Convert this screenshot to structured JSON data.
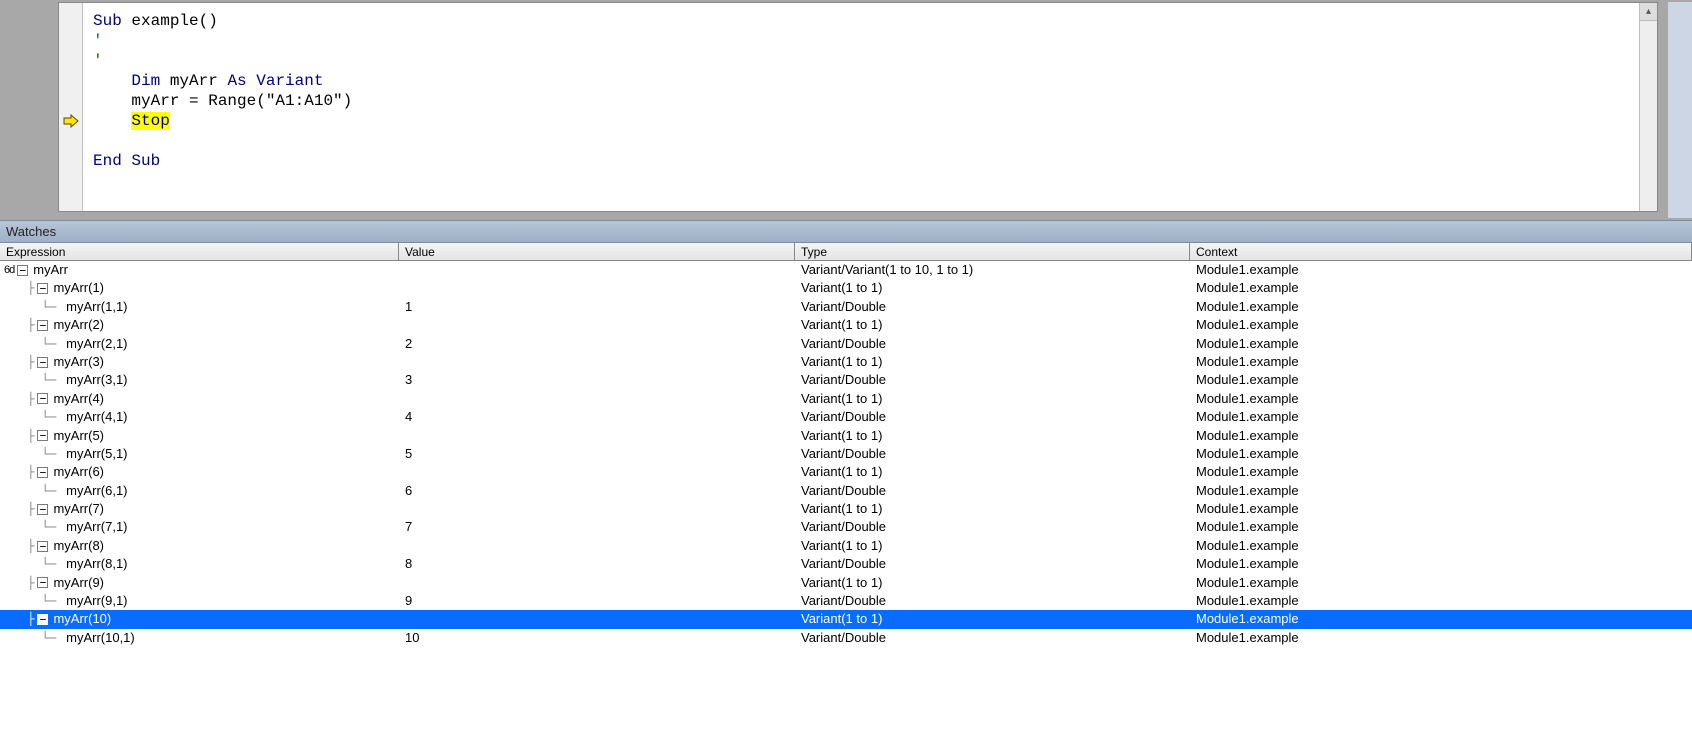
{
  "code": {
    "line1_a": "Sub",
    "line1_b": " example()",
    "line2": "'",
    "line3": "'",
    "line4_a": "    Dim",
    "line4_b": " myArr ",
    "line4_c": "As Variant",
    "line5": "    myArr = Range(\"A1:A10\")",
    "line6_pad": "    ",
    "line6_stop": "Stop",
    "line8": "End Sub"
  },
  "watches": {
    "title": "Watches",
    "headers": {
      "expression": "Expression",
      "value": "Value",
      "type": "Type",
      "context": "Context"
    },
    "rows": [
      {
        "indent": 0,
        "glasses": true,
        "box": "-",
        "expr": "myArr",
        "value": "",
        "type": "Variant/Variant(1 to 10, 1 to 1)",
        "context": "Module1.example",
        "selected": false
      },
      {
        "indent": 1,
        "box": "-",
        "expr": "myArr(1)",
        "value": "",
        "type": "Variant(1 to 1)",
        "context": "Module1.example",
        "selected": false
      },
      {
        "indent": 2,
        "expr": "myArr(1,1)",
        "value": "1",
        "type": "Variant/Double",
        "context": "Module1.example",
        "selected": false
      },
      {
        "indent": 1,
        "box": "-",
        "expr": "myArr(2)",
        "value": "",
        "type": "Variant(1 to 1)",
        "context": "Module1.example",
        "selected": false
      },
      {
        "indent": 2,
        "expr": "myArr(2,1)",
        "value": "2",
        "type": "Variant/Double",
        "context": "Module1.example",
        "selected": false
      },
      {
        "indent": 1,
        "box": "-",
        "expr": "myArr(3)",
        "value": "",
        "type": "Variant(1 to 1)",
        "context": "Module1.example",
        "selected": false
      },
      {
        "indent": 2,
        "expr": "myArr(3,1)",
        "value": "3",
        "type": "Variant/Double",
        "context": "Module1.example",
        "selected": false
      },
      {
        "indent": 1,
        "box": "-",
        "expr": "myArr(4)",
        "value": "",
        "type": "Variant(1 to 1)",
        "context": "Module1.example",
        "selected": false
      },
      {
        "indent": 2,
        "expr": "myArr(4,1)",
        "value": "4",
        "type": "Variant/Double",
        "context": "Module1.example",
        "selected": false
      },
      {
        "indent": 1,
        "box": "-",
        "expr": "myArr(5)",
        "value": "",
        "type": "Variant(1 to 1)",
        "context": "Module1.example",
        "selected": false
      },
      {
        "indent": 2,
        "expr": "myArr(5,1)",
        "value": "5",
        "type": "Variant/Double",
        "context": "Module1.example",
        "selected": false
      },
      {
        "indent": 1,
        "box": "-",
        "expr": "myArr(6)",
        "value": "",
        "type": "Variant(1 to 1)",
        "context": "Module1.example",
        "selected": false
      },
      {
        "indent": 2,
        "expr": "myArr(6,1)",
        "value": "6",
        "type": "Variant/Double",
        "context": "Module1.example",
        "selected": false
      },
      {
        "indent": 1,
        "box": "-",
        "expr": "myArr(7)",
        "value": "",
        "type": "Variant(1 to 1)",
        "context": "Module1.example",
        "selected": false
      },
      {
        "indent": 2,
        "expr": "myArr(7,1)",
        "value": "7",
        "type": "Variant/Double",
        "context": "Module1.example",
        "selected": false
      },
      {
        "indent": 1,
        "box": "-",
        "expr": "myArr(8)",
        "value": "",
        "type": "Variant(1 to 1)",
        "context": "Module1.example",
        "selected": false
      },
      {
        "indent": 2,
        "expr": "myArr(8,1)",
        "value": "8",
        "type": "Variant/Double",
        "context": "Module1.example",
        "selected": false
      },
      {
        "indent": 1,
        "box": "-",
        "expr": "myArr(9)",
        "value": "",
        "type": "Variant(1 to 1)",
        "context": "Module1.example",
        "selected": false
      },
      {
        "indent": 2,
        "expr": "myArr(9,1)",
        "value": "9",
        "type": "Variant/Double",
        "context": "Module1.example",
        "selected": false
      },
      {
        "indent": 1,
        "box": "-",
        "expr": "myArr(10)",
        "value": "",
        "type": "Variant(1 to 1)",
        "context": "Module1.example",
        "selected": true
      },
      {
        "indent": 2,
        "expr": "myArr(10,1)",
        "value": "10",
        "type": "Variant/Double",
        "context": "Module1.example",
        "selected": false
      }
    ]
  }
}
